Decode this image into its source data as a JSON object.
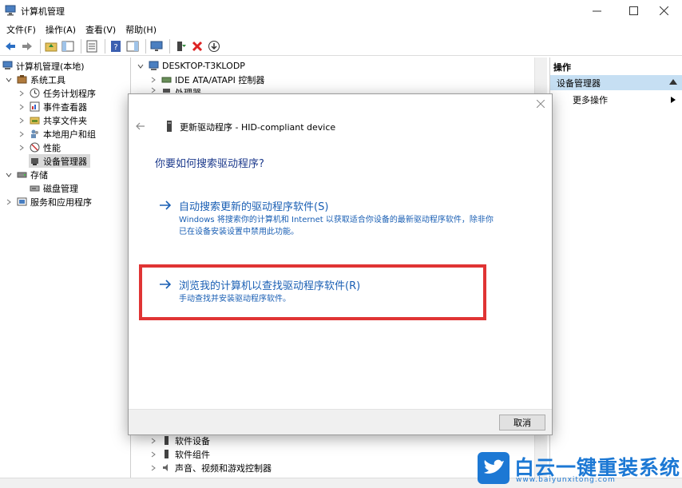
{
  "window": {
    "title": "计算机管理"
  },
  "menu": [
    "文件(F)",
    "操作(A)",
    "查看(V)",
    "帮助(H)"
  ],
  "left_tree": {
    "root": "计算机管理(本地)",
    "system_tools": "系统工具",
    "task_scheduler": "任务计划程序",
    "event_viewer": "事件查看器",
    "shared_folders": "共享文件夹",
    "local_users": "本地用户和组",
    "performance": "性能",
    "device_manager": "设备管理器",
    "storage": "存储",
    "disk_management": "磁盘管理",
    "services_apps": "服务和应用程序"
  },
  "device_tree": {
    "computer": "DESKTOP-T3KLODP",
    "ide": "IDE ATA/ATAPI 控制器",
    "processor": "处理器",
    "software_devices": "软件设备",
    "software_components": "软件组件",
    "sound": "声音、视频和游戏控制器"
  },
  "actions": {
    "header": "操作",
    "section": "设备管理器",
    "more": "更多操作"
  },
  "dialog": {
    "title": "更新驱动程序 - HID-compliant device",
    "heading": "你要如何搜索驱动程序?",
    "option_auto_title": "自动搜索更新的驱动程序软件(S)",
    "option_auto_desc": "Windows 将搜索你的计算机和 Internet 以获取适合你设备的最新驱动程序软件，除非你已在设备安装设置中禁用此功能。",
    "option_browse_title": "浏览我的计算机以查找驱动程序软件(R)",
    "option_browse_desc": "手动查找并安装驱动程序软件。",
    "cancel": "取消"
  },
  "watermark": {
    "brand": "白云一键重装系统",
    "url": "www.baiyunxitong.com"
  },
  "colors": {
    "link_blue": "#1a5fb4",
    "heading_blue": "#1c3a8c",
    "highlight_red": "#e03434",
    "action_selected": "#c6dff3",
    "watermark_blue": "#1c78d4"
  }
}
